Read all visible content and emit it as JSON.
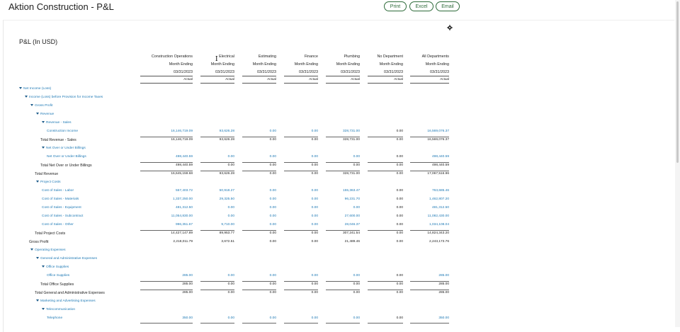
{
  "app_title": "Aktion Construction - P&L",
  "toolbar": {
    "print": "Print",
    "excel": "Excel",
    "email": "Email"
  },
  "report_title": "P&L (In USD)",
  "columns": [
    {
      "name": "Construction Operations",
      "period": "Month Ending",
      "date": "03/31/2023",
      "basis": "Actual"
    },
    {
      "name": "Electrical",
      "period": "Month Ending",
      "date": "03/31/2023",
      "basis": "Actual"
    },
    {
      "name": "Estimating",
      "period": "Month Ending",
      "date": "03/31/2023",
      "basis": "Actual"
    },
    {
      "name": "Finance",
      "period": "Month Ending",
      "date": "03/31/2023",
      "basis": "Actual"
    },
    {
      "name": "Plumbing",
      "period": "Month Ending",
      "date": "03/31/2023",
      "basis": "Actual"
    },
    {
      "name": "No Department",
      "period": "Month Ending",
      "date": "03/31/2023",
      "basis": "Actual"
    },
    {
      "name": "All Departments",
      "period": "Month Ending",
      "date": "03/31/2023",
      "basis": "Actual"
    }
  ],
  "rows": [
    {
      "label": "Net Income (Loss)",
      "indent": 0,
      "caret": true,
      "style": "link",
      "values": []
    },
    {
      "label": "Income (Loss) before Provision for Income Taxes",
      "indent": 1,
      "caret": true,
      "style": "link",
      "values": []
    },
    {
      "label": "Gross Profit",
      "indent": 2,
      "caret": true,
      "style": "link",
      "values": []
    },
    {
      "label": "Revenue",
      "indent": 3,
      "caret": true,
      "style": "link",
      "values": []
    },
    {
      "label": "Revenue - Sales",
      "indent": 4,
      "caret": true,
      "style": "link",
      "values": []
    },
    {
      "label": "Construction Income",
      "indent": 5,
      "caret": false,
      "style": "link",
      "values": [
        "16,146,719.09",
        "93,626.28",
        "0.00",
        "0.00",
        "328,731.00",
        "0.00",
        "16,569,076.37"
      ]
    },
    {
      "label": "Total Revenue - Sales",
      "indent": 4,
      "caret": false,
      "style": "plain",
      "sep": true,
      "values": [
        "16,146,719.09",
        "93,626.28",
        "0.00",
        "0.00",
        "328,731.00",
        "0.00",
        "16,569,076.37"
      ]
    },
    {
      "label": "Net Over or Under Billings",
      "indent": 4,
      "caret": true,
      "style": "link",
      "values": []
    },
    {
      "label": "Net Over or Under Billings",
      "indent": 5,
      "caret": false,
      "style": "link",
      "values": [
        "498,440.59",
        "0.00",
        "0.00",
        "0.00",
        "0.00",
        "0.00",
        "498,440.59"
      ]
    },
    {
      "label": "Total Net Over or Under Billings",
      "indent": 4,
      "caret": false,
      "style": "plain",
      "sep": true,
      "values": [
        "498,440.59",
        "0.00",
        "0.00",
        "0.00",
        "0.00",
        "0.00",
        "498,440.59"
      ]
    },
    {
      "label": "Total Revenue",
      "indent": 3,
      "caret": false,
      "style": "plain",
      "sep": true,
      "values": [
        "16,645,159.68",
        "93,626.28",
        "0.00",
        "0.00",
        "328,731.00",
        "0.00",
        "17,067,516.96"
      ]
    },
    {
      "label": "Project Costs",
      "indent": 3,
      "caret": true,
      "style": "link",
      "values": []
    },
    {
      "label": "Cost of Sales - Labor",
      "indent": 4,
      "caret": false,
      "style": "link",
      "values": [
        "557,403.72",
        "50,918.27",
        "0.00",
        "0.00",
        "155,363.47",
        "0.00",
        "763,685.46"
      ]
    },
    {
      "label": "Cost of Sales - Materials",
      "indent": 4,
      "caret": false,
      "style": "link",
      "values": [
        "1,337,250.00",
        "29,325.50",
        "0.00",
        "0.00",
        "96,231.70",
        "0.00",
        "1,462,807.20"
      ]
    },
    {
      "label": "Cost of Sales - Equipment",
      "indent": 4,
      "caret": false,
      "style": "link",
      "values": [
        "481,312.50",
        "0.00",
        "0.00",
        "0.00",
        "0.00",
        "0.00",
        "481,312.50"
      ]
    },
    {
      "label": "Cost of Sales - Subcontract",
      "indent": 4,
      "caret": false,
      "style": "link",
      "values": [
        "11,054,830.00",
        "0.00",
        "0.00",
        "0.00",
        "27,600.00",
        "0.00",
        "11,082,430.00"
      ]
    },
    {
      "label": "Cost of Sales - Other",
      "indent": 4,
      "caret": false,
      "style": "link",
      "values": [
        "996,351.67",
        "9,710.00",
        "0.00",
        "0.00",
        "28,046.37",
        "0.00",
        "1,034,108.04"
      ]
    },
    {
      "label": "Total Project Costs",
      "indent": 3,
      "caret": false,
      "style": "plain",
      "sep": true,
      "values": [
        "14,427,147.89",
        "89,953.77",
        "0.00",
        "0.00",
        "307,241.54",
        "0.00",
        "14,824,343.20"
      ]
    },
    {
      "label": "Gross Profit",
      "indent": 2,
      "caret": false,
      "style": "plain",
      "values": [
        "2,218,011.79",
        "3,672.51",
        "0.00",
        "0.00",
        "21,489.46",
        "0.00",
        "2,243,173.76"
      ]
    },
    {
      "label": "Operating Expenses",
      "indent": 2,
      "caret": true,
      "style": "link",
      "values": []
    },
    {
      "label": "General and Administrative Expenses",
      "indent": 3,
      "caret": true,
      "style": "link",
      "values": []
    },
    {
      "label": "Office Supplies",
      "indent": 4,
      "caret": true,
      "style": "link",
      "values": []
    },
    {
      "label": "Office Supplies",
      "indent": 5,
      "caret": false,
      "style": "link",
      "values": [
        "285.00",
        "0.00",
        "0.00",
        "0.00",
        "0.00",
        "0.00",
        "285.00"
      ]
    },
    {
      "label": "Total Office Supplies",
      "indent": 4,
      "caret": false,
      "style": "plain",
      "sep": true,
      "values": [
        "285.00",
        "0.00",
        "0.00",
        "0.00",
        "0.00",
        "0.00",
        "285.00"
      ]
    },
    {
      "label": "Total General and Administrative Expenses",
      "indent": 3,
      "caret": false,
      "style": "plain",
      "sep": true,
      "values": [
        "285.00",
        "0.00",
        "0.00",
        "0.00",
        "0.00",
        "0.00",
        "285.00"
      ]
    },
    {
      "label": "Marketing and Advertising Expenses",
      "indent": 3,
      "caret": true,
      "style": "link",
      "values": []
    },
    {
      "label": "Telecommunication",
      "indent": 4,
      "caret": true,
      "style": "link",
      "values": []
    },
    {
      "label": "Telephone",
      "indent": 5,
      "caret": false,
      "style": "link",
      "values": [
        "350.00",
        "0.00",
        "0.00",
        "0.00",
        "0.00",
        "0.00",
        "350.00"
      ]
    }
  ]
}
